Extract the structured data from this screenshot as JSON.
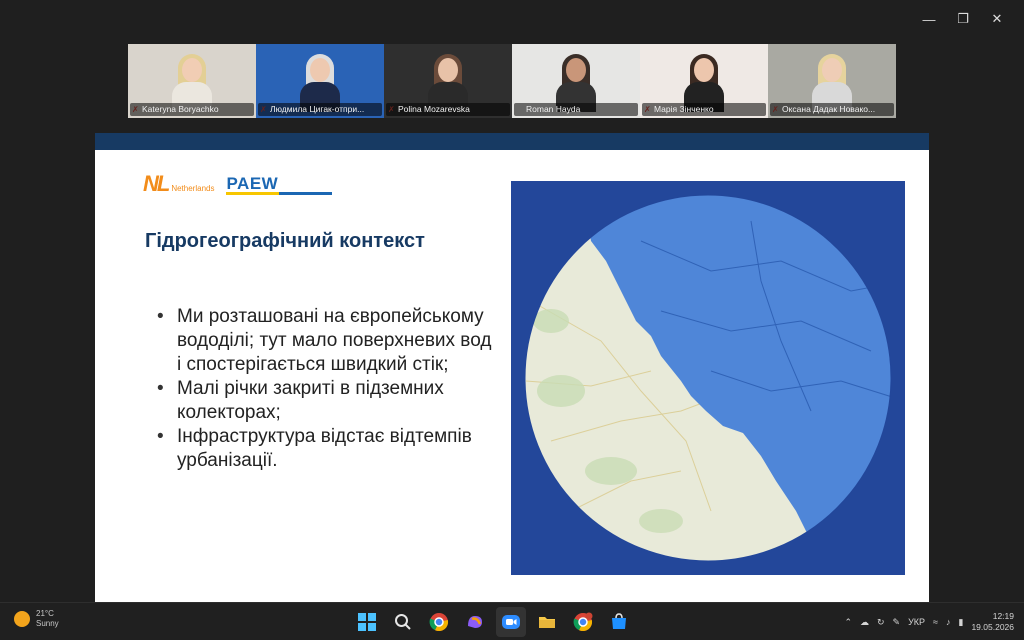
{
  "window": {
    "controls": [
      "minimize-icon",
      "restore-icon",
      "close-icon"
    ]
  },
  "participants": [
    {
      "name": "Kateryna Boryachko",
      "muted": true,
      "active": false,
      "bg": "#d9d4cc",
      "hair": "#e3cf95",
      "skin": "#f1cdb4",
      "shirt": "#ebe7df"
    },
    {
      "name": "Людмила Цигак-отпри...",
      "muted": true,
      "active": false,
      "bg": "#2a63b6",
      "hair": "#dddddd",
      "skin": "#eec9b0",
      "shirt": "#1d2a4a"
    },
    {
      "name": "Polina Mozarevska",
      "muted": true,
      "active": false,
      "bg": "#2f2f2f",
      "hair": "#6b4b3a",
      "skin": "#e8c2a8",
      "shirt": "#2a2a2a"
    },
    {
      "name": "Roman Hayda",
      "muted": false,
      "active": true,
      "bg": "#e6e6e4",
      "hair": "#3a2e28",
      "skin": "#c99679",
      "shirt": "#333333"
    },
    {
      "name": "Марія Зінченко",
      "muted": true,
      "active": false,
      "bg": "#efe9e5",
      "hair": "#3b2a22",
      "skin": "#edc6ad",
      "shirt": "#222222"
    },
    {
      "name": "Оксана Дадак Новако...",
      "muted": true,
      "active": false,
      "bg": "#a9a9a2",
      "hair": "#e6d39d",
      "skin": "#efcdb6",
      "shirt": "#d9d9d9"
    }
  ],
  "slide": {
    "logo_nl": "NL",
    "logo_nl_word": "Netherlands",
    "logo_paew": "PAEW",
    "title": "Гідрогеографічний контекст",
    "bullets": [
      "Ми розташовані на європейському вододілі; тут мало поверхневих вод і спостерігається швидкий стік;",
      "Малі річки закриті в підземних колекторах;",
      "Інфраструктура відстає відтемпів урбанізації."
    ],
    "colors": {
      "title": "#173a63",
      "topbar": "#173a63",
      "map_frame": "#23479a",
      "basin": "#4f86d8",
      "land": "#e8ead9"
    }
  },
  "taskbar": {
    "weather_temp": "21°C",
    "weather_desc": "Sunny",
    "apps": [
      "start-icon",
      "search-icon",
      "chrome-icon",
      "copilot-icon",
      "zoom-icon",
      "file-explorer-icon",
      "chrome-profile-icon",
      "store-icon"
    ],
    "language": "УКР",
    "time": "12:19",
    "date": "19.05.2026"
  }
}
